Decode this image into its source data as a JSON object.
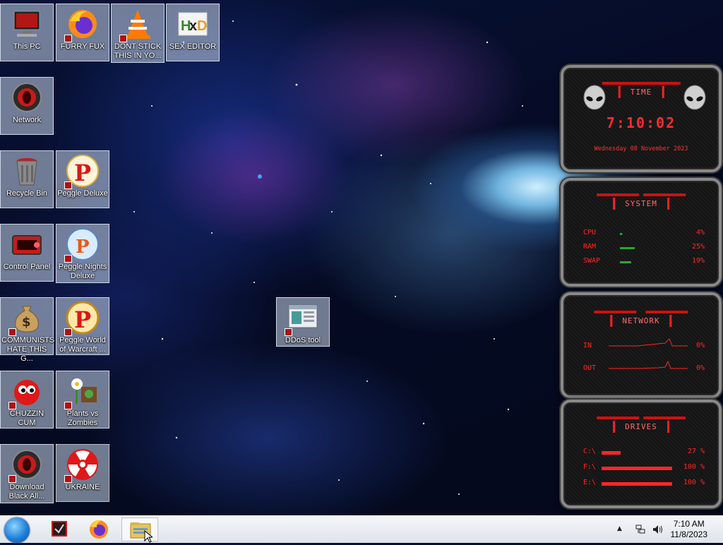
{
  "desktop_icons": [
    {
      "label": "This PC",
      "icon": "computer-icon"
    },
    {
      "label": "FURRY FUX",
      "icon": "firefox-icon"
    },
    {
      "label": "DONT STICK THIS IN YO...",
      "icon": "vlc-cone-icon"
    },
    {
      "label": "SEX EDITOR",
      "icon": "hxd-icon"
    },
    {
      "label": "Network",
      "icon": "network-icon"
    },
    {
      "label": "Recycle Bin",
      "icon": "recycle-bin-icon"
    },
    {
      "label": "Peggle Deluxe",
      "icon": "peggle-icon"
    },
    {
      "label": "Control Panel",
      "icon": "control-panel-icon"
    },
    {
      "label": "Peggle Nights Deluxe",
      "icon": "peggle-nights-icon"
    },
    {
      "label": "COMMUNISTS HATE THIS G...",
      "icon": "money-bag-icon"
    },
    {
      "label": "Peggle World of Warcraft ...",
      "icon": "peggle-wow-icon"
    },
    {
      "label": "CHUZZIN CUM",
      "icon": "chuzzle-icon"
    },
    {
      "label": "Plants vs Zombies",
      "icon": "plants-vs-zombies-icon"
    },
    {
      "label": "Download Black All...",
      "icon": "alien-icon"
    },
    {
      "label": "UKRAINE",
      "icon": "radiation-icon"
    },
    {
      "label": "DDoS tool",
      "icon": "window-app-icon"
    }
  ],
  "widget": {
    "time": {
      "title": "TIME",
      "clock": "7:10:02",
      "date": "Wednesday 08 November 2023"
    },
    "system": {
      "title": "SYSTEM",
      "rows": [
        {
          "label": "CPU",
          "value": "4%",
          "level": 0.04
        },
        {
          "label": "RAM",
          "value": "25%",
          "level": 0.25
        },
        {
          "label": "SWAP",
          "value": "19%",
          "level": 0.19
        }
      ]
    },
    "network": {
      "title": "NETWORK",
      "rows": [
        {
          "label": "IN",
          "value": "0%"
        },
        {
          "label": "OUT",
          "value": "0%"
        }
      ]
    },
    "drives": {
      "title": "DRIVES",
      "rows": [
        {
          "label": "C:\\",
          "value": "27 %",
          "level": 0.27
        },
        {
          "label": "F:\\",
          "value": "100 %",
          "level": 1.0
        },
        {
          "label": "E:\\",
          "value": "100 %",
          "level": 1.0
        }
      ]
    }
  },
  "taskbar": {
    "pinned": [
      "start-orb",
      "media-app",
      "firefox",
      "file-explorer"
    ],
    "clock_time": "7:10 AM",
    "clock_date": "11/8/2023"
  },
  "colors": {
    "accent": "#ff2626",
    "taskbar": "#e6eaef"
  }
}
